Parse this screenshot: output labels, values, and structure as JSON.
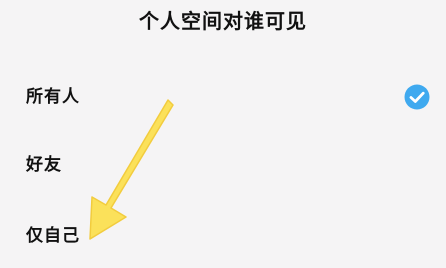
{
  "header": {
    "title": "个人空间对谁可见"
  },
  "options": [
    {
      "label": "所有人",
      "selected": true
    },
    {
      "label": "好友",
      "selected": false
    },
    {
      "label": "仅自己",
      "selected": false
    }
  ],
  "colors": {
    "background": "#f5f4f5",
    "check_accent": "#3fa9ef",
    "annotation_arrow": "#fbe15a"
  },
  "icons": {
    "selected": "check-circle-icon",
    "annotation": "annotation-arrow-icon"
  }
}
